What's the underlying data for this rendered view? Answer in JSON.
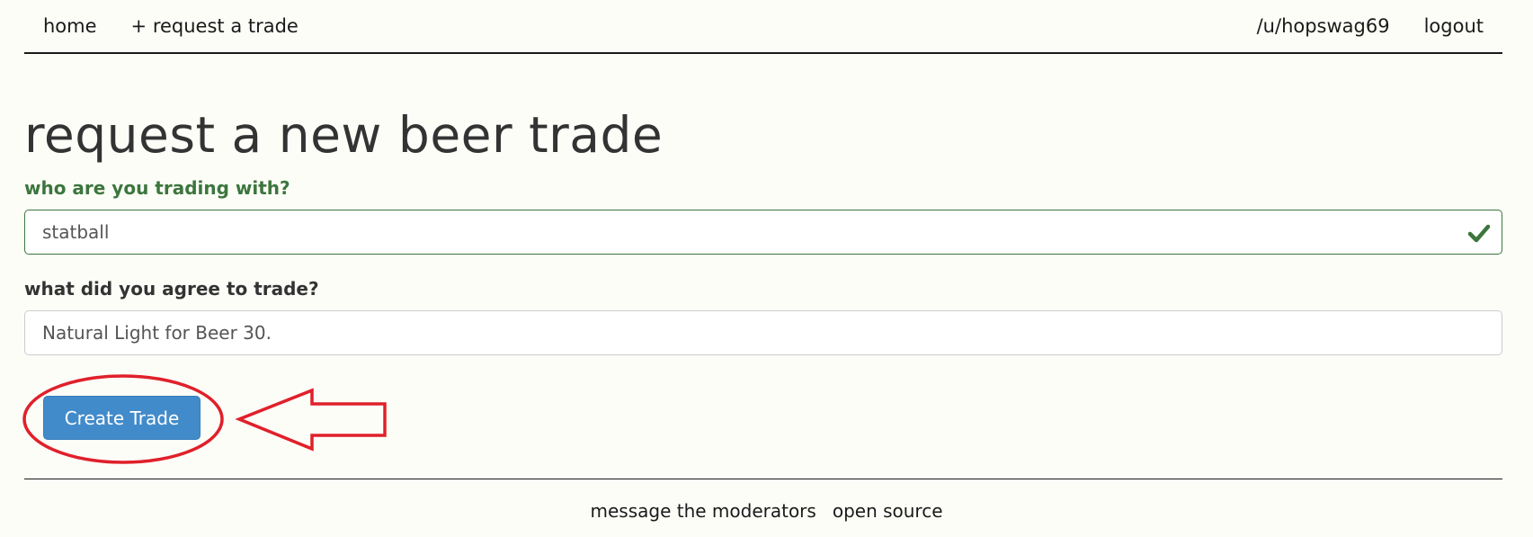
{
  "nav": {
    "home": "home",
    "request_trade": "+ request a trade",
    "user": "/u/hopswag69",
    "logout": "logout"
  },
  "page": {
    "title": "request a new beer trade"
  },
  "form": {
    "partner_label": "who are you trading with?",
    "partner_value": "statball",
    "partner_status_icon": "check-icon",
    "trade_label": "what did you agree to trade?",
    "trade_value": "Natural Light for Beer 30.",
    "submit_label": "Create Trade"
  },
  "footer": {
    "moderators": "message the moderators",
    "open_source": "open source"
  },
  "colors": {
    "success": "#3c763d",
    "primary": "#428bca",
    "annotation": "#e0202a"
  }
}
